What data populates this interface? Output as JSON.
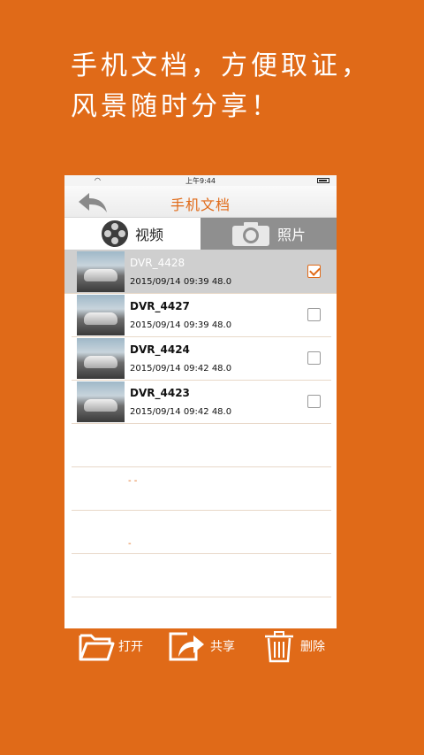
{
  "headline": {
    "line1": "手机文档，方便取证，",
    "line2": "风景随时分享！"
  },
  "status_bar": {
    "time": "上午9:44",
    "wifi_icon": "wifi-icon",
    "battery_icon": "battery-icon"
  },
  "navbar": {
    "title": "手机文档",
    "back_icon": "back-arrow-icon"
  },
  "tabs": [
    {
      "label": "视频",
      "icon": "film-reel-icon",
      "active": true
    },
    {
      "label": "照片",
      "icon": "camera-icon",
      "active": false
    }
  ],
  "files": [
    {
      "name": "DVR_4428",
      "meta": "2015/09/14 09:39 48.0",
      "selected": true
    },
    {
      "name": "DVR_4427",
      "meta": "2015/09/14 09:39 48.0",
      "selected": false
    },
    {
      "name": "DVR_4424",
      "meta": "2015/09/14 09:42 48.0",
      "selected": false
    },
    {
      "name": "DVR_4423",
      "meta": "2015/09/14 09:42 48.0",
      "selected": false
    }
  ],
  "toolbar": {
    "open_label": "打开",
    "share_label": "共享",
    "delete_label": "删除"
  },
  "colors": {
    "brand": "#e06a18",
    "selected_row": "#cfcfcf",
    "inactive_tab": "#8f8f8f"
  }
}
